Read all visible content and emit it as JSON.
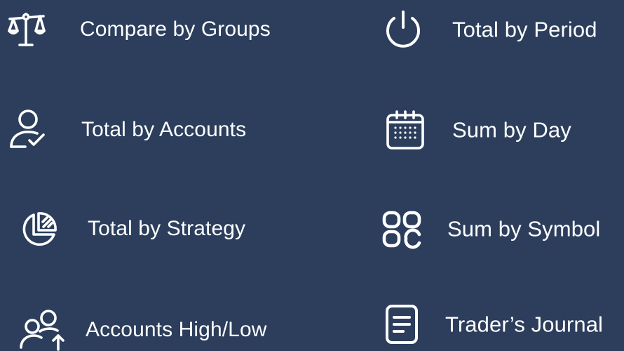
{
  "background_color": "#2c3e5c",
  "text_color": "#ffffff",
  "menu": {
    "items": [
      {
        "label": "Compare by Groups",
        "icon": "scale-icon"
      },
      {
        "label": "Total by Period",
        "icon": "power-icon"
      },
      {
        "label": "Total by Accounts",
        "icon": "user-check-icon"
      },
      {
        "label": "Sum by Day",
        "icon": "calendar-icon"
      },
      {
        "label": "Total by Strategy",
        "icon": "pie-chart-icon"
      },
      {
        "label": "Sum by Symbol",
        "icon": "symbols-grid-icon"
      },
      {
        "label": "Accounts High/Low",
        "icon": "users-arrow-icon"
      },
      {
        "label": "Trader’s Journal",
        "icon": "journal-icon"
      }
    ]
  }
}
